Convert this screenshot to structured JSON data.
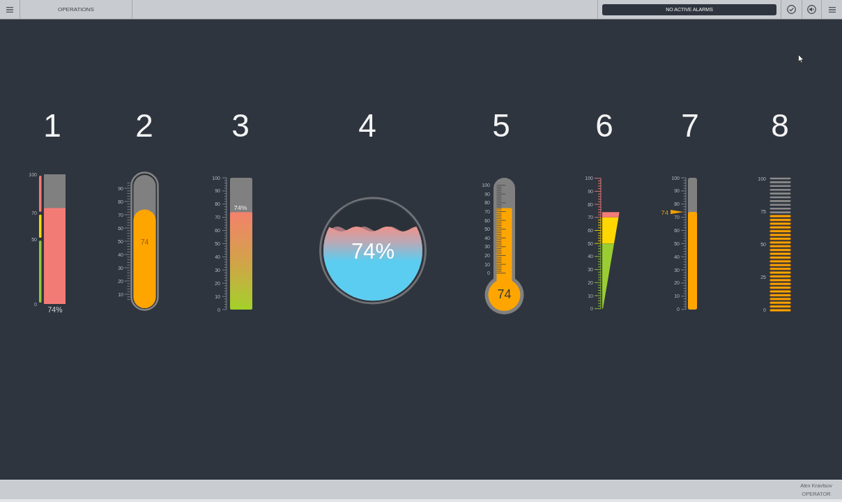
{
  "top_bar": {
    "section_title": "OPERATIONS",
    "alarm_banner": "NO ACTIVE ALARMS"
  },
  "gauges": [
    {
      "number": "1",
      "kind": "zone-bar",
      "level": 0.74,
      "reading": "74%",
      "scale": [
        "100",
        "70",
        "50",
        "0"
      ],
      "zones": [
        {
          "color": "#f27b76"
        },
        {
          "color": "#f5d800"
        },
        {
          "color": "#8ec63f"
        }
      ]
    },
    {
      "number": "2",
      "kind": "tube",
      "level": 0.74,
      "reading": "74",
      "scale": [
        "90",
        "80",
        "70",
        "60",
        "50",
        "40",
        "30",
        "20",
        "10"
      ]
    },
    {
      "number": "3",
      "kind": "gradient-bar",
      "level": 0.74,
      "reading": "74%",
      "scale": [
        "100",
        "90",
        "80",
        "70",
        "60",
        "50",
        "40",
        "30",
        "20",
        "10",
        "0"
      ]
    },
    {
      "number": "4",
      "kind": "tank",
      "level": 0.74,
      "reading": "74%"
    },
    {
      "number": "5",
      "kind": "thermometer",
      "level": 0.74,
      "reading": "74",
      "scale": [
        "100",
        "90",
        "80",
        "70",
        "60",
        "50",
        "40",
        "30",
        "20",
        "10",
        "0"
      ]
    },
    {
      "number": "6",
      "kind": "wedge",
      "level": 0.74,
      "scale": [
        "100",
        "90",
        "80",
        "70",
        "60",
        "50",
        "40",
        "30",
        "20",
        "10",
        "0"
      ],
      "zones": [
        {
          "color": "#f47c78"
        },
        {
          "color": "#ffd700"
        },
        {
          "color": "#9acd32"
        }
      ]
    },
    {
      "number": "7",
      "kind": "pointer-bar",
      "level": 0.74,
      "reading": "74",
      "scale": [
        "100",
        "90",
        "80",
        "70",
        "60",
        "50",
        "40",
        "30",
        "20",
        "10",
        "0"
      ]
    },
    {
      "number": "8",
      "kind": "segment-bar",
      "level": 0.74,
      "scale": [
        "100",
        "75",
        "50",
        "25",
        "0"
      ]
    }
  ],
  "status_bar": {
    "user_name": "Alex Kravtsov",
    "role": "OPERATOR"
  }
}
